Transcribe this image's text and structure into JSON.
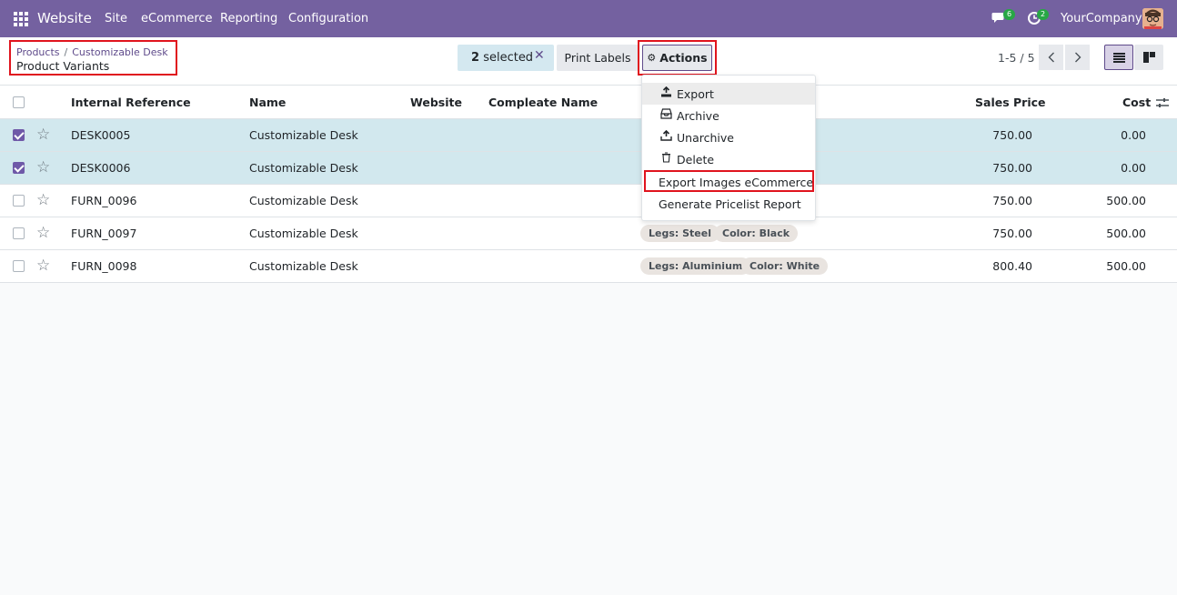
{
  "navbar": {
    "brand": "Website",
    "menu": [
      "Site",
      "eCommerce",
      "Reporting",
      "Configuration"
    ],
    "chat_badge": "6",
    "activity_badge": "2",
    "company": "YourCompany"
  },
  "breadcrumb": {
    "items": [
      "Products",
      "Customizable Desk"
    ],
    "separator": "/",
    "title": "Product Variants"
  },
  "selection": {
    "count": "2",
    "label": "selected",
    "unselect": "✕"
  },
  "toolbar": {
    "print_labels": "Print Labels",
    "actions": "Actions"
  },
  "pager": {
    "value": "1-5 / 5"
  },
  "table": {
    "headers": {
      "internal_reference": "Internal Reference",
      "name": "Name",
      "website": "Website",
      "complete_name": "Compleate Name",
      "sales_price": "Sales Price",
      "cost": "Cost"
    },
    "rows": [
      {
        "ref": "DESK0005",
        "name": "Customizable Desk",
        "tags": [],
        "price": "750.00",
        "cost": "0.00",
        "selected": true
      },
      {
        "ref": "DESK0006",
        "name": "Customizable Desk",
        "tags": [],
        "price": "750.00",
        "cost": "0.00",
        "selected": true
      },
      {
        "ref": "FURN_0096",
        "name": "Customizable Desk",
        "tags": [],
        "price": "750.00",
        "cost": "500.00",
        "selected": false
      },
      {
        "ref": "FURN_0097",
        "name": "Customizable Desk",
        "tags": [
          "Legs: Steel",
          "Color: Black"
        ],
        "price": "750.00",
        "cost": "500.00",
        "selected": false
      },
      {
        "ref": "FURN_0098",
        "name": "Customizable Desk",
        "tags": [
          "Legs: Aluminium",
          "Color: White"
        ],
        "price": "800.40",
        "cost": "500.00",
        "selected": false
      }
    ]
  },
  "actions_menu": {
    "items": [
      "Export",
      "Archive",
      "Unarchive",
      "Delete",
      "Export Images eCommerce",
      "Generate Pricelist Report"
    ]
  },
  "colors": {
    "navbar": "#7461a0",
    "highlight": "#e0141e",
    "selected_row": "#d2e8ee",
    "accent": "#5f4b8b"
  }
}
